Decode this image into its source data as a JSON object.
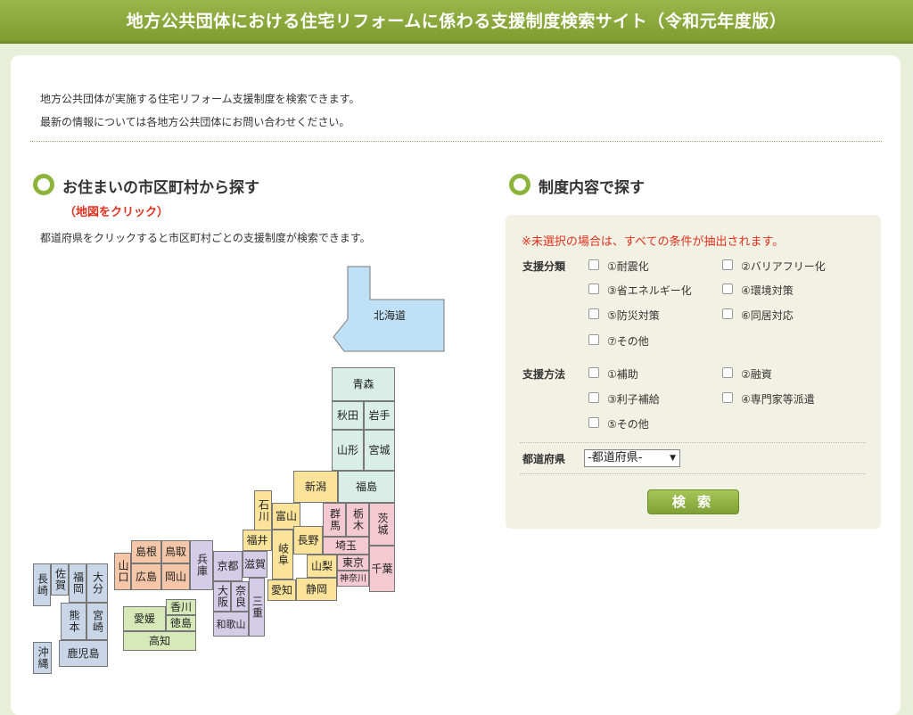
{
  "header": {
    "title": "地方公共団体における住宅リフォームに係わる支援制度検索サイト（令和元年度版）"
  },
  "intro": {
    "line1": "地方公共団体が実施する住宅リフォーム支援制度を検索できます。",
    "line2": "最新の情報については各地方公共団体にお問い合わせください。"
  },
  "map_section": {
    "title": "お住まいの市区町村から探す",
    "note": "（地図をクリック）",
    "description": "都道府県をクリックすると市区町村ごとの支援制度が検索できます。"
  },
  "map": {
    "hokkaido": "北海道",
    "aomori": "青森",
    "akita": "秋田",
    "iwate": "岩手",
    "yamagata": "山形",
    "miyagi": "宮城",
    "fukushima": "福島",
    "niigata": "新潟",
    "ishikawa": "石川",
    "toyama": "富山",
    "gunma": "群馬",
    "tochigi": "栃木",
    "ibaraki": "茨城",
    "fukui": "福井",
    "gifu": "岐阜",
    "nagano": "長野",
    "saitama": "埼玉",
    "yamanashi": "山梨",
    "tokyo": "東京",
    "chiba": "千葉",
    "kanagawa": "神奈川",
    "aichi": "愛知",
    "shizuoka": "静岡",
    "shiga": "滋賀",
    "kyoto": "京都",
    "hyogo": "兵庫",
    "osaka": "大阪",
    "nara": "奈良",
    "mie": "三重",
    "wakayama": "和歌山",
    "shimane": "島根",
    "tottori": "鳥取",
    "yamaguchi": "山口",
    "hiroshima": "広島",
    "okayama": "岡山",
    "kagawa": "香川",
    "ehime": "愛媛",
    "tokushima": "徳島",
    "kochi": "高知",
    "nagasaki": "長崎",
    "saga": "佐賀",
    "fukuoka": "福岡",
    "oita": "大分",
    "kumamoto": "熊本",
    "miyazaki": "宮崎",
    "kagoshima": "鹿児島",
    "okinawa": "沖縄"
  },
  "filter_section": {
    "title": "制度内容で探す",
    "warning": "※未選択の場合は、すべての条件が抽出されます。",
    "category_label": "支援分類",
    "categories": [
      "①耐震化",
      "②バリアフリー化",
      "③省エネルギー化",
      "④環境対策",
      "⑤防災対策",
      "⑥同居対応",
      "⑦その他"
    ],
    "method_label": "支援方法",
    "methods": [
      "①補助",
      "②融資",
      "③利子補給",
      "④専門家等派遣",
      "⑤その他"
    ],
    "prefecture_label": "都道府県",
    "prefecture_selected": "-都道府県-",
    "search_button": "検 索"
  },
  "colors": {
    "accent": "#8db43a",
    "header": "#86a236",
    "warning": "#e0301e",
    "hokkaido": "#bfe0f5",
    "tohoku": "#d8eee6",
    "kanto": "#f4c9d2",
    "chubu": "#fbe49a",
    "kinki": "#d5cce7",
    "chugoku": "#f5c7a8",
    "shikoku": "#d7e9b8",
    "kyushu": "#c8d6e8"
  }
}
